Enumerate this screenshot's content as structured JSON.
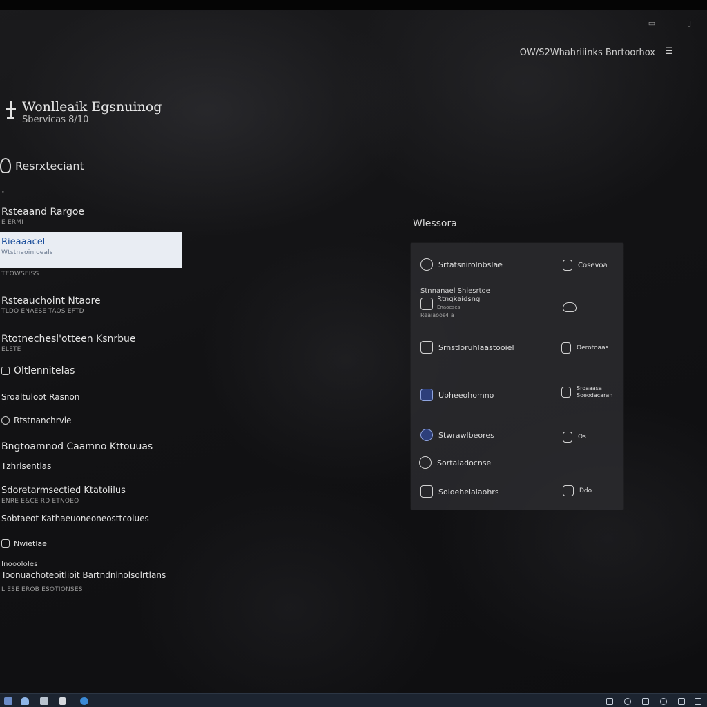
{
  "window": {
    "account_label": "OW/S2Whahriiinks Bnrtoorhox"
  },
  "app": {
    "title": "Wonlleaik Egsnuinog",
    "subtitle": "Sbervicas 8/10"
  },
  "section": {
    "label": "Resrxteciant",
    "tiny_mark": "•"
  },
  "nav": {
    "items": [
      {
        "label": "Rsteaand Rargoe",
        "sub": "E ERMI"
      },
      {
        "label": "Rieaaacel",
        "sub": "Wtstnaoinioeals"
      },
      {
        "label": "",
        "sub": "TEOWSEISS"
      },
      {
        "label": "Rsteauchoint Ntaore",
        "sub": "TLDO ENAESE TAOS EFTD"
      },
      {
        "label": "Rtotnechesl'otteen Ksnrbue",
        "sub": "ELETE"
      },
      {
        "label": "Oltlennitelas",
        "sub": ""
      },
      {
        "label": "Sroaltuloot Rasnon",
        "sub": ""
      },
      {
        "label": "Rtstnanchrvie",
        "sub": ""
      },
      {
        "label": "Bngtoamnod Caamno Kttouuas",
        "sub": ""
      },
      {
        "label": "Tzhrlsentlas",
        "sub": ""
      },
      {
        "label": "Sdoretarmsectied Ktatolilus",
        "sub": "ENRE E&CE RD ETNOEO"
      },
      {
        "label": "Sobtaeot Kathaeuoneoneosttcolues",
        "sub": ""
      },
      {
        "label": "Nwietlae",
        "sub": ""
      },
      {
        "label": "Inooololes",
        "sub": ""
      },
      {
        "label": "Toonuachoteoitlioit Bartndnlnolsolrtlans",
        "sub": "L ESE EROB ESOTIONSES"
      }
    ]
  },
  "panel": {
    "title": "Wlessora",
    "items": [
      {
        "label": "Srtatsnirolnbslae",
        "icon": "camera-icon"
      },
      {
        "label": "Cosevoa",
        "icon": "document-icon"
      },
      {
        "label": "Stnnanael Shiesrtoe",
        "sub_label": "Rtngkaidsng",
        "meta": "Enaoeses",
        "extra": "Reaiaoos4 a",
        "icon": "image-icon"
      },
      {
        "label": "",
        "icon": "cloud-icon"
      },
      {
        "label": "Srnstloruhlaastooiel",
        "icon": "folder-icon"
      },
      {
        "label": "Oerotoaas",
        "icon": "notes-icon"
      },
      {
        "label": "Ubheeohomno",
        "icon": "calendar-icon"
      },
      {
        "label": "Sroaaasa Soeodacaran",
        "icon": "edit-icon"
      },
      {
        "label": "Stwrawlbeores",
        "icon": "gear-icon"
      },
      {
        "label": "Os",
        "icon": "frame-icon"
      },
      {
        "label": "Sortaladocnse",
        "icon": "chat-icon"
      },
      {
        "label": "Soloehelaiaohrs",
        "icon": "window-icon"
      },
      {
        "label": "Ddo",
        "icon": "box-icon"
      }
    ]
  },
  "colors": {
    "selected_bg": "#e9edf3",
    "selected_text": "#1c4f9c",
    "panel_bg": "#2c2c30",
    "taskbar_bg": "#1c2430"
  }
}
